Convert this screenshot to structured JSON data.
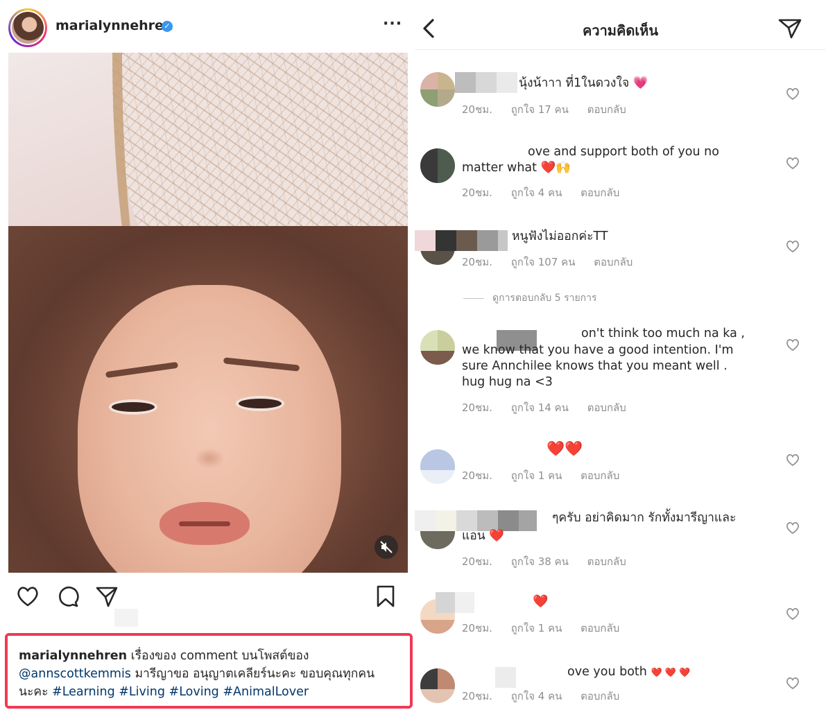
{
  "post": {
    "username": "marialynnehren",
    "caption": {
      "username": "marialynnehren",
      "text_1": "เรื่องของ comment บนโพสต์ของ",
      "mention": "@annscottkemmis",
      "text_2": "มารีญาขอ อนุญาตเคลียร์นะคะ ขอบคุณทุกคน",
      "text_3": "นะคะ",
      "hashtags": [
        "#Learning",
        "#Living",
        "#Loving",
        "#AnimalLover"
      ]
    }
  },
  "comments_panel": {
    "title": "ความคิดเห็น",
    "view_replies": "ดูการตอบกลับ 5 รายการ",
    "comments": [
      {
        "text": "นุ้งน้าาา ที่1ในดวงใจ",
        "emoji": "💗",
        "time": "20ชม.",
        "likes": "ถูกใจ 17 คน",
        "reply": "ตอบกลับ"
      },
      {
        "text_line1": "ove and support both of you no",
        "text_line2": "matter what",
        "emoji": "❤️🙌",
        "time": "20ชม.",
        "likes": "ถูกใจ 4 คน",
        "reply": "ตอบกลับ"
      },
      {
        "text": "หนูฟังไม่ออกค่ะTT",
        "time": "20ชม.",
        "likes": "ถูกใจ 107 คน",
        "reply": "ตอบกลับ"
      },
      {
        "text_line1": "on't think too much na ka ,",
        "text_line2": "we know that you have a good intention. I'm",
        "text_line3": "sure Annchilee knows that you meant well .",
        "text_line4": "hug hug na <3",
        "time": "20ชม.",
        "likes": "ถูกใจ 14 คน",
        "reply": "ตอบกลับ"
      },
      {
        "emoji": "❤️❤️",
        "time": "20ชม.",
        "likes": "ถูกใจ 1 คน",
        "reply": "ตอบกลับ"
      },
      {
        "text_line1": "ๆครับ อย่าคิดมาก รักทั้งมารีญาและ",
        "text_line2": "แอน",
        "emoji": "❤️",
        "time": "20ชม.",
        "likes": "ถูกใจ 38 คน",
        "reply": "ตอบกลับ"
      },
      {
        "emoji": "❤️",
        "time": "20ชม.",
        "likes": "ถูกใจ 1 คน",
        "reply": "ตอบกลับ"
      },
      {
        "text": "ove you both",
        "emoji": "❤️ ❤️ ❤️",
        "time": "20ชม.",
        "likes": "ถูกใจ 4 คน",
        "reply": "ตอบกลับ"
      }
    ]
  },
  "colors": {
    "highlight_border": "#ef3a55",
    "link": "#00376b",
    "verified": "#3897f0",
    "meta_gray": "#8e8e8e"
  },
  "icons": [
    "verified-badge-icon",
    "more-options-icon",
    "mute-icon",
    "heart-icon",
    "comment-icon",
    "share-icon",
    "bookmark-icon",
    "back-arrow-icon",
    "direct-send-icon"
  ]
}
